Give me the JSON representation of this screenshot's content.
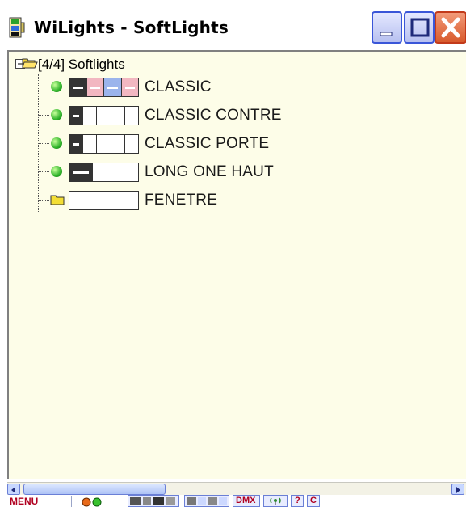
{
  "window": {
    "title": "WiLights - SoftLights"
  },
  "tree": {
    "root": {
      "label": "[4/4] Softlights"
    },
    "items": [
      {
        "label": "CLASSIC",
        "status": "active",
        "pattern": [
          "dark",
          "pink",
          "blue",
          "pink"
        ]
      },
      {
        "label": "CLASSIC CONTRE",
        "status": "active",
        "pattern": [
          "dark",
          "white",
          "white",
          "white",
          "white"
        ]
      },
      {
        "label": "CLASSIC PORTE",
        "status": "active",
        "pattern": [
          "dark",
          "white",
          "white",
          "white",
          "white"
        ]
      },
      {
        "label": "LONG ONE HAUT",
        "status": "active",
        "pattern": [
          "dark",
          "white",
          "white"
        ]
      },
      {
        "label": "FENETRE",
        "status": "folder",
        "pattern": [
          "white"
        ]
      }
    ]
  },
  "toolbar": {
    "menu_label": "MENU",
    "dmx_label": "DMX",
    "help_label": "?",
    "c_label": "C"
  },
  "colors": {
    "panel_bg": "#fdfde8",
    "accent_red": "#b00020",
    "led_green": "#2fb32a",
    "title_close": "#d85a2c"
  }
}
